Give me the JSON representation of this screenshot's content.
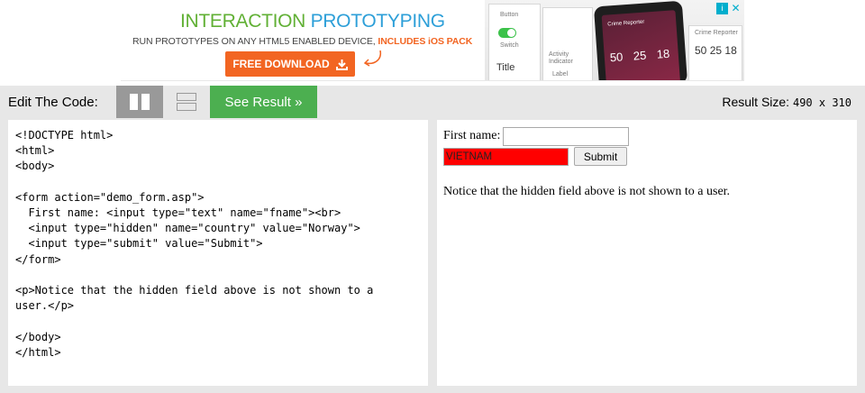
{
  "ad": {
    "title_part1": "INTERACTION",
    "title_part2": "PROTOTYPING",
    "subtitle_main": "RUN PROTOTYPES ON ANY HTML5 ENABLED DEVICE,",
    "subtitle_highlight": "INCLUDES iOS PACK",
    "button_label": "FREE DOWNLOAD",
    "art_labels": [
      "Button",
      "Switch",
      "Title",
      "Label",
      "Activity Indicator",
      "Crime Reporter"
    ],
    "art_numbers": [
      "50",
      "25",
      "18"
    ],
    "brand_color": "#f26522"
  },
  "toolbar": {
    "edit_label": "Edit The Code:",
    "see_result_label": "See Result »",
    "result_size_label": "Result Size:",
    "result_size_value": "490 x 310"
  },
  "code": {
    "source": "<!DOCTYPE html>\n<html>\n<body>\n\n<form action=\"demo_form.asp\">\n  First name: <input type=\"text\" name=\"fname\"><br>\n  <input type=\"hidden\" name=\"country\" value=\"Norway\">\n  <input type=\"submit\" value=\"Submit\">\n</form>\n\n<p>Notice that the hidden field above is not shown to a\nuser.</p>\n\n</body>\n</html>"
  },
  "result": {
    "first_name_label": "First name:",
    "first_name_value": "",
    "hidden_field_value": "VIETNAM",
    "submit_label": "Submit",
    "notice_text": "Notice that the hidden field above is not shown to a user."
  },
  "colors": {
    "toolbar_bg": "#e7e7e7",
    "see_result_bg": "#4caf50",
    "hidden_field_bg": "#ff0000"
  }
}
